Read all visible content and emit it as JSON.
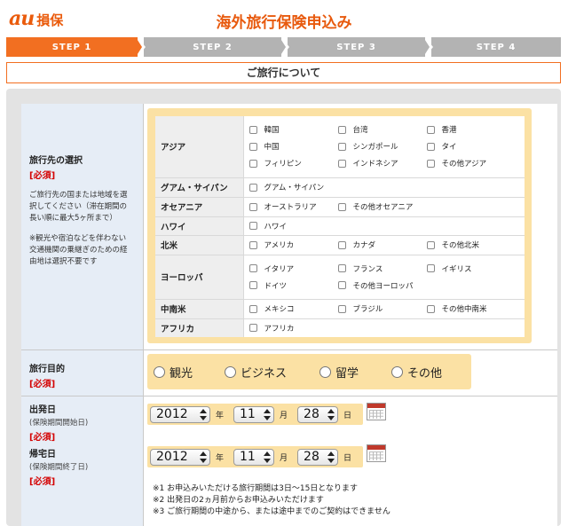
{
  "header": {
    "logo_au": "au",
    "logo_name": "損保",
    "title": "海外旅行保険申込み"
  },
  "steps": [
    {
      "label": "STEP 1",
      "active": true
    },
    {
      "label": "STEP 2",
      "active": false
    },
    {
      "label": "STEP 3",
      "active": false
    },
    {
      "label": "STEP 4",
      "active": false
    }
  ],
  "section_title": "ご旅行について",
  "destination": {
    "title": "旅行先の選択",
    "required": "[必須]",
    "help1": "ご旅行先の国または地域を選択してください（滞在期間の長い順に最大5ヶ所まで）",
    "help2": "※観光や宿泊などを伴わない交通機関の乗継ぎのための経由地は選択不要です",
    "regions": [
      {
        "name": "アジア",
        "options": [
          "韓国",
          "台湾",
          "香港",
          "中国",
          "シンガポール",
          "タイ",
          "フィリピン",
          "インドネシア",
          "その他アジア"
        ]
      },
      {
        "name": "グアム・サイパン",
        "options": [
          "グアム・サイパン"
        ]
      },
      {
        "name": "オセアニア",
        "options": [
          "オーストラリア",
          "その他オセアニア"
        ]
      },
      {
        "name": "ハワイ",
        "options": [
          "ハワイ"
        ]
      },
      {
        "name": "北米",
        "options": [
          "アメリカ",
          "カナダ",
          "その他北米"
        ]
      },
      {
        "name": "ヨーロッパ",
        "options": [
          "イタリア",
          "フランス",
          "イギリス",
          "ドイツ",
          "その他ヨーロッパ"
        ]
      },
      {
        "name": "中南米",
        "options": [
          "メキシコ",
          "ブラジル",
          "その他中南米"
        ]
      },
      {
        "name": "アフリカ",
        "options": [
          "アフリカ"
        ]
      }
    ]
  },
  "purpose": {
    "title": "旅行目的",
    "required": "[必須]",
    "options": [
      "観光",
      "ビジネス",
      "留学",
      "その他"
    ]
  },
  "departure": {
    "title": "出発日",
    "sub": "(保険期間開始日)",
    "required": "[必須]",
    "year": "2012",
    "month": "11",
    "day": "28"
  },
  "return": {
    "title": "帰宅日",
    "sub": "(保険期間終了日)",
    "required": "[必須]",
    "year": "2012",
    "month": "11",
    "day": "28"
  },
  "units": {
    "year": "年",
    "month": "月",
    "day": "日"
  },
  "notes": [
    "※1 お申込みいただける旅行期間は3日〜15日となります",
    "※2 出発日の2ヵ月前からお申込みいただけます",
    "※3 ご旅行期間の中途から、または途中までのご契約はできません"
  ],
  "colors": {
    "accent": "#f26f21",
    "highlight": "#fbe1a4",
    "label_bg": "#e6edf6",
    "required": "#d40000"
  }
}
